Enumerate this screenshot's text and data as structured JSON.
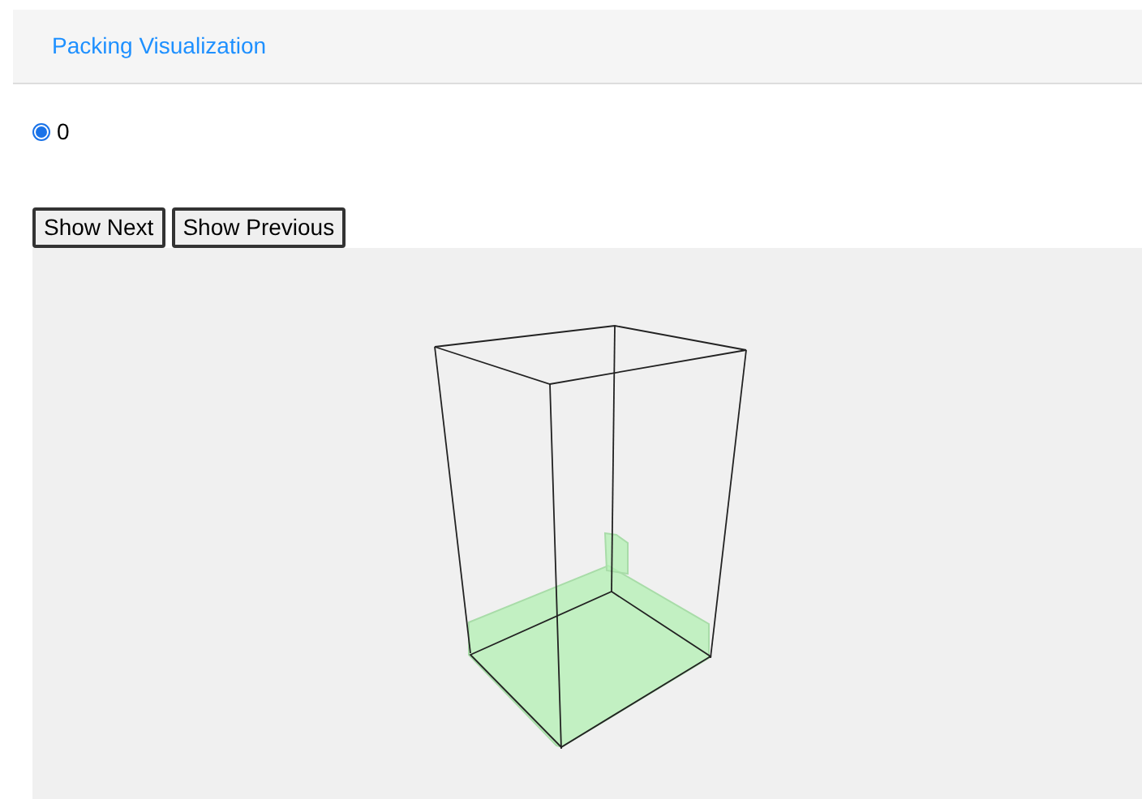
{
  "header": {
    "title": "Packing Visualization"
  },
  "radio_options": [
    {
      "label": "0",
      "selected": true
    }
  ],
  "buttons": [
    "Show Next",
    "Show Previous"
  ]
}
